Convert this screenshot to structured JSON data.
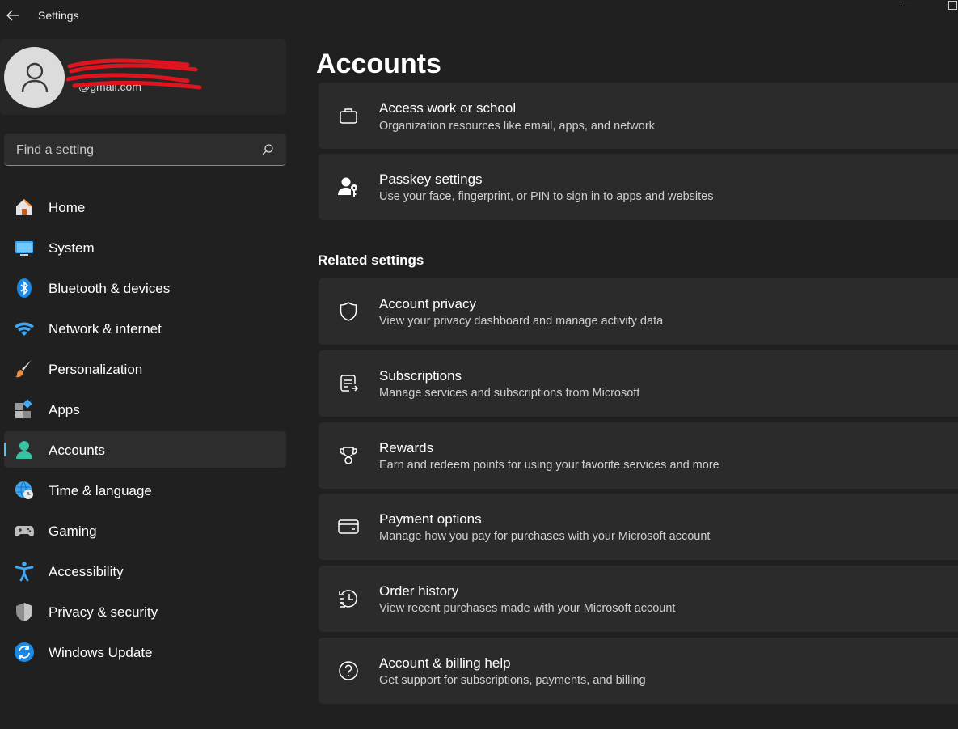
{
  "window": {
    "title": "Settings"
  },
  "profile": {
    "name": "",
    "email": "@gmail.com"
  },
  "search": {
    "placeholder": "Find a setting"
  },
  "nav": {
    "items": [
      {
        "label": "Home",
        "icon": "home-icon"
      },
      {
        "label": "System",
        "icon": "system-icon"
      },
      {
        "label": "Bluetooth & devices",
        "icon": "bluetooth-icon"
      },
      {
        "label": "Network & internet",
        "icon": "wifi-icon"
      },
      {
        "label": "Personalization",
        "icon": "brush-icon"
      },
      {
        "label": "Apps",
        "icon": "apps-icon"
      },
      {
        "label": "Accounts",
        "icon": "person-icon",
        "selected": true
      },
      {
        "label": "Time & language",
        "icon": "globe-clock-icon"
      },
      {
        "label": "Gaming",
        "icon": "gamepad-icon"
      },
      {
        "label": "Accessibility",
        "icon": "accessibility-icon"
      },
      {
        "label": "Privacy & security",
        "icon": "shield-icon"
      },
      {
        "label": "Windows Update",
        "icon": "update-icon"
      }
    ]
  },
  "main": {
    "title": "Accounts",
    "cards": [
      {
        "title": "Access work or school",
        "subtitle": "Organization resources like email, apps, and network",
        "icon": "briefcase-icon"
      },
      {
        "title": "Passkey settings",
        "subtitle": "Use your face, fingerprint, or PIN to sign in to apps and websites",
        "icon": "passkey-icon"
      }
    ],
    "related_title": "Related settings",
    "related": [
      {
        "title": "Account privacy",
        "subtitle": "View your privacy dashboard and manage activity data",
        "icon": "shield-outline-icon"
      },
      {
        "title": "Subscriptions",
        "subtitle": "Manage services and subscriptions from Microsoft",
        "icon": "subscription-icon"
      },
      {
        "title": "Rewards",
        "subtitle": "Earn and redeem points for using your favorite services and more",
        "icon": "trophy-icon"
      },
      {
        "title": "Payment options",
        "subtitle": "Manage how you pay for purchases with your Microsoft account",
        "icon": "credit-card-icon"
      },
      {
        "title": "Order history",
        "subtitle": "View recent purchases made with your Microsoft account",
        "icon": "history-icon"
      },
      {
        "title": "Account & billing help",
        "subtitle": "Get support for subscriptions, payments, and billing",
        "icon": "help-icon"
      }
    ]
  },
  "colors": {
    "background": "#202020",
    "card": "#2b2b2b",
    "accent": "#4cc2ff",
    "redaction": "#e0141e"
  }
}
